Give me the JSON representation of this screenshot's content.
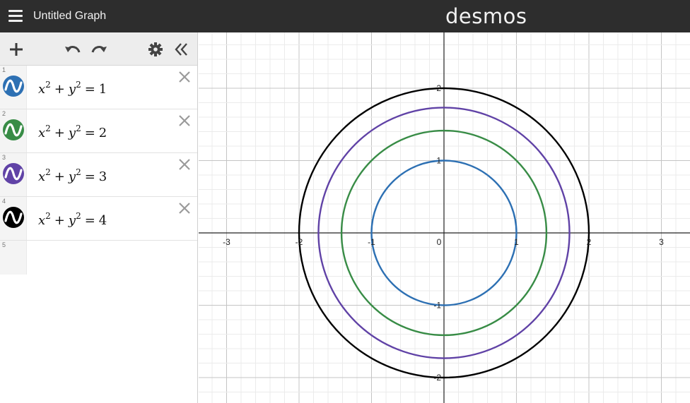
{
  "header": {
    "title": "Untitled Graph",
    "brand": "desmos"
  },
  "toolbar": {
    "add_icon": "plus-icon",
    "undo_icon": "undo-icon",
    "redo_icon": "redo-icon",
    "settings_icon": "gear-icon",
    "collapse_icon": "double-chevron-left-icon"
  },
  "expressions": [
    {
      "num": "1",
      "color": "#2d70b3",
      "lhs_a": "x",
      "lhs_b": "y",
      "exp": "2",
      "rhs": "1"
    },
    {
      "num": "2",
      "color": "#388c46",
      "lhs_a": "x",
      "lhs_b": "y",
      "exp": "2",
      "rhs": "2"
    },
    {
      "num": "3",
      "color": "#6042a6",
      "lhs_a": "x",
      "lhs_b": "y",
      "exp": "2",
      "rhs": "3"
    },
    {
      "num": "4",
      "color": "#000000",
      "lhs_a": "x",
      "lhs_b": "y",
      "exp": "2",
      "rhs": "4"
    }
  ],
  "empty_row_num": "5",
  "graph": {
    "x_ticks": [
      "-3",
      "-2",
      "-1",
      "0",
      "1",
      "2",
      "3"
    ],
    "y_ticks": [
      "2",
      "1",
      "-1",
      "-2"
    ],
    "curves": [
      {
        "radius_squared": 1,
        "color": "#2d70b3"
      },
      {
        "radius_squared": 2,
        "color": "#388c46"
      },
      {
        "radius_squared": 3,
        "color": "#6042a6"
      },
      {
        "radius_squared": 4,
        "color": "#000000"
      }
    ]
  }
}
